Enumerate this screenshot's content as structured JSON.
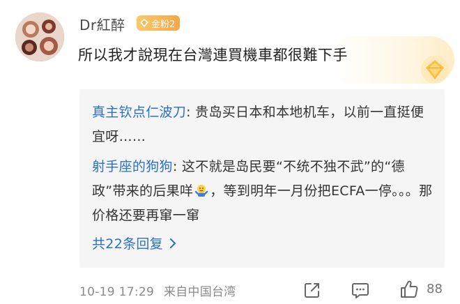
{
  "comment": {
    "username": "Dr紅醉",
    "badge_label": "金粉2",
    "text": "所以我才說現在台灣連買機車都很難下手"
  },
  "replies": [
    {
      "author": "真主钦点仁波刀",
      "sep": ": ",
      "text": "贵岛买日本和本地机车，以前一直挺便宜呀……"
    },
    {
      "author": "射手座的狗狗",
      "sep": ": ",
      "text_before": "这不就是岛民要“不统不独不武”的“德政”带来的后果咩",
      "emoji": "shrug-emoji",
      "text_after": "，等到明年一月份把ECFA一停。。。那价格还要再窜一窜"
    }
  ],
  "more_replies_label": "共22条回复",
  "footer": {
    "timestamp": "10-19 17:29",
    "source": "来自中国台湾",
    "like_count": "88"
  },
  "icons": {
    "badge": "diamond-icon",
    "gold": "gold-diamond-icon",
    "share": "share-icon",
    "reply": "comment-icon",
    "like": "thumbs-up-icon",
    "more": "chevron-right-icon"
  },
  "colors": {
    "link": "#2a6fc8",
    "badge": "#f2a84a",
    "meta": "#8a8a8a"
  }
}
